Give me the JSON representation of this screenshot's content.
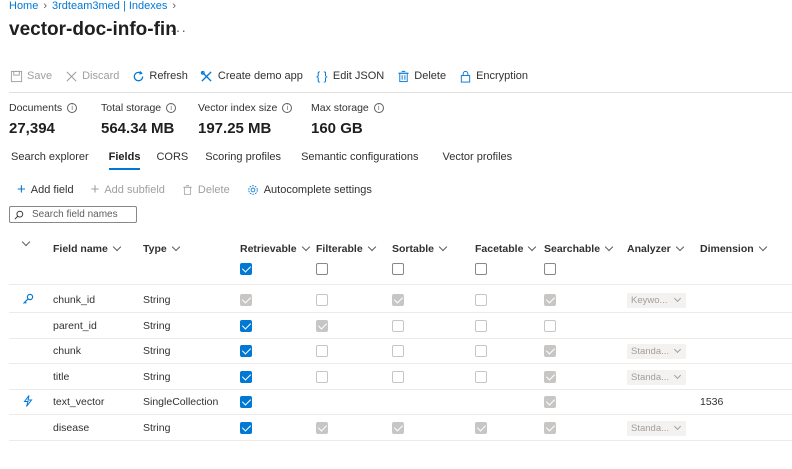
{
  "breadcrumb": {
    "home": "Home",
    "service": "3rdteam3med | Indexes"
  },
  "page_title": "vector-doc-info-fin",
  "title_more": "···",
  "toolbar": {
    "save": "Save",
    "discard": "Discard",
    "refresh": "Refresh",
    "create_demo_app": "Create demo app",
    "edit_json": "Edit JSON",
    "delete": "Delete",
    "encryption": "Encryption"
  },
  "stats": {
    "documents": {
      "label": "Documents",
      "value": "27,394"
    },
    "total_storage": {
      "label": "Total storage",
      "value": "564.34 MB"
    },
    "vector_index_size": {
      "label": "Vector index size",
      "value": "197.25 MB"
    },
    "max_storage": {
      "label": "Max storage",
      "value": "160 GB"
    }
  },
  "tabs": [
    "Search explorer",
    "Fields",
    "CORS",
    "Scoring profiles",
    "Semantic configurations",
    "Vector profiles"
  ],
  "active_tab": "Fields",
  "fields_toolbar": {
    "add_field": "Add field",
    "add_subfield": "Add subfield",
    "delete": "Delete",
    "autocomplete": "Autocomplete settings"
  },
  "search": {
    "placeholder": "Search field names"
  },
  "columns": {
    "field_name": "Field name",
    "type": "Type",
    "retrievable": "Retrievable",
    "filterable": "Filterable",
    "sortable": "Sortable",
    "facetable": "Facetable",
    "searchable": "Searchable",
    "analyzer": "Analyzer",
    "dimension": "Dimension"
  },
  "header_checks": {
    "retrievable": true,
    "filterable": false,
    "sortable": false,
    "facetable": false,
    "searchable": false
  },
  "rows": [
    {
      "name": "chunk_id",
      "type": "String",
      "icon": "key-icon",
      "retrievable": "checked-dis",
      "filterable": "dis",
      "sortable": "checked-dis",
      "facetable": "dis",
      "searchable": "checked-dis",
      "analyzer": "Keywo...",
      "dimension": ""
    },
    {
      "name": "parent_id",
      "type": "String",
      "icon": "",
      "retrievable": "checked",
      "filterable": "checked-dis",
      "sortable": "dis",
      "facetable": "dis",
      "searchable": "dis",
      "analyzer": "",
      "dimension": ""
    },
    {
      "name": "chunk",
      "type": "String",
      "icon": "",
      "retrievable": "checked",
      "filterable": "dis",
      "sortable": "dis",
      "facetable": "dis",
      "searchable": "checked-dis",
      "analyzer": "Standa...",
      "dimension": ""
    },
    {
      "name": "title",
      "type": "String",
      "icon": "",
      "retrievable": "checked",
      "filterable": "dis",
      "sortable": "dis",
      "facetable": "dis",
      "searchable": "checked-dis",
      "analyzer": "Standa...",
      "dimension": ""
    },
    {
      "name": "text_vector",
      "type": "SingleCollection",
      "icon": "vector-icon",
      "retrievable": "checked",
      "filterable": "",
      "sortable": "",
      "facetable": "",
      "searchable": "checked-dis",
      "analyzer": "",
      "dimension": "1536"
    },
    {
      "name": "disease",
      "type": "String",
      "icon": "",
      "retrievable": "checked",
      "filterable": "checked-dis",
      "sortable": "checked-dis",
      "facetable": "checked-dis",
      "searchable": "checked-dis",
      "analyzer": "Standa...",
      "dimension": ""
    }
  ],
  "colors": {
    "accent": "#0078d4",
    "disabled_check": "#c8c6c4"
  }
}
